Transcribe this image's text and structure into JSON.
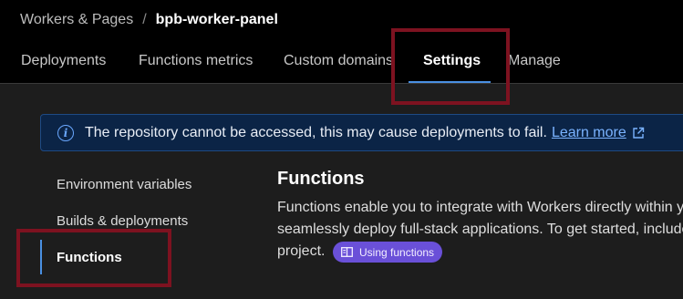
{
  "breadcrumb": {
    "parent": "Workers & Pages",
    "separator": "/",
    "current": "bpb-worker-panel"
  },
  "tabs": [
    {
      "label": "Deployments",
      "active": false
    },
    {
      "label": "Functions metrics",
      "active": false
    },
    {
      "label": "Custom domains",
      "active": false
    },
    {
      "label": "Settings",
      "active": true
    },
    {
      "label": "Manage",
      "active": false
    }
  ],
  "banner": {
    "icon": "info-icon",
    "text": "The repository cannot be accessed, this may cause deployments to fail.",
    "link_label": "Learn more",
    "link_icon": "external-link-icon"
  },
  "sidebar": {
    "items": [
      {
        "label": "Environment variables",
        "active": false
      },
      {
        "label": "Builds & deployments",
        "active": false
      },
      {
        "label": "Functions",
        "active": true
      }
    ]
  },
  "main": {
    "title": "Functions",
    "description_lines": [
      "Functions enable you to integrate with Workers directly within y",
      "seamlessly deploy full-stack applications. To get started, include",
      "project."
    ],
    "pill_label": "Using functions",
    "pill_icon": "book-icon"
  },
  "colors": {
    "accent": "#4a90e2",
    "highlight": "#7d1220",
    "pill": "#6a50d8",
    "banner_bg": "#0b2446"
  }
}
